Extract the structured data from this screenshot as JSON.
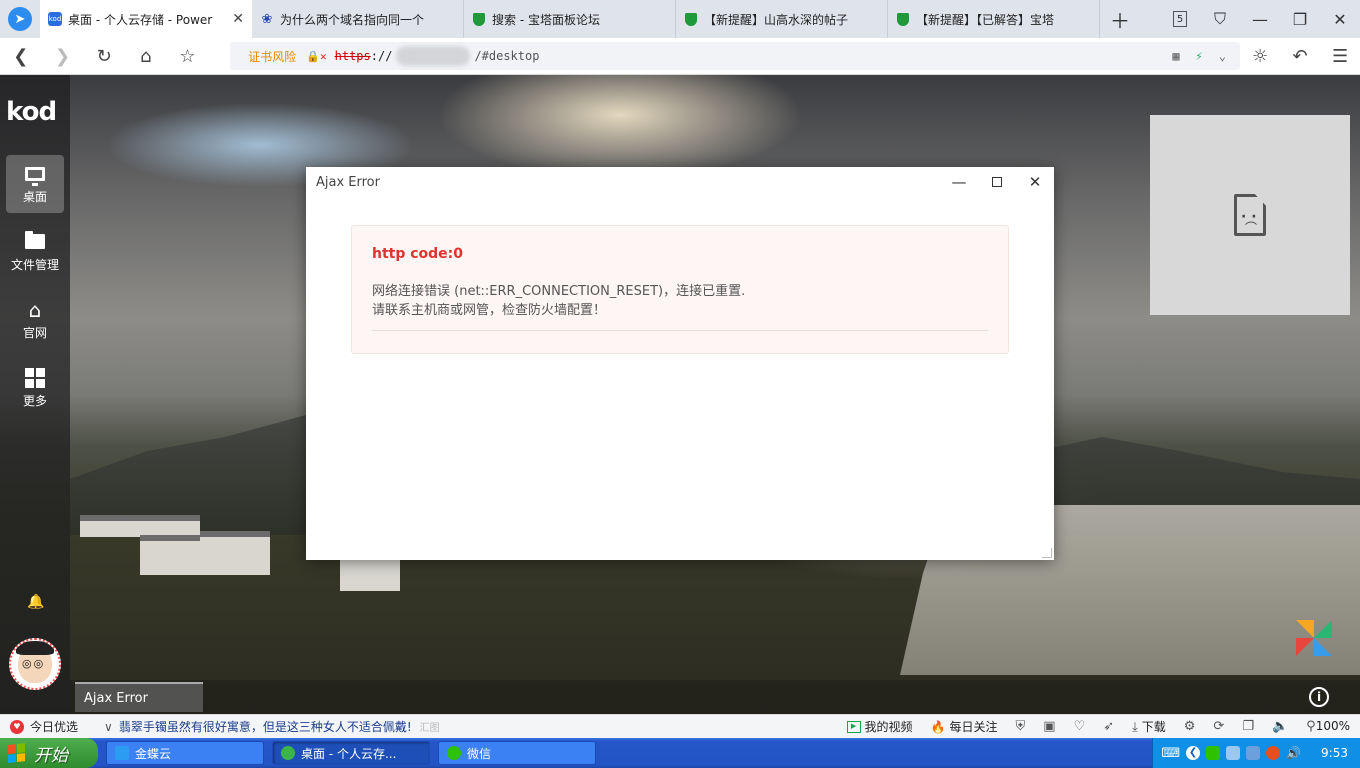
{
  "browser": {
    "tabs": [
      {
        "title": "桌面 - 个人云存储 - Power",
        "favicon": "kod-favicon",
        "active": true
      },
      {
        "title": "为什么两个域名指向同一个",
        "favicon": "baidu-paw-icon",
        "active": false
      },
      {
        "title": "搜索 - 宝塔面板论坛",
        "favicon": "bt-shield-icon",
        "active": false
      },
      {
        "title": "【新提醒】山高水深的帖子",
        "favicon": "bt-shield-icon",
        "active": false
      },
      {
        "title": "【新提醒】【已解答】宝塔",
        "favicon": "bt-shield-icon",
        "active": false
      }
    ],
    "tab_count": "5",
    "cert_warning": "证书风险",
    "url_protocol": "https",
    "url_sep": "://",
    "url_path": "/#desktop",
    "accent": "#2d8cf0"
  },
  "dock": {
    "logo": "kod",
    "items": [
      {
        "label": "桌面",
        "icon": "desktop-monitor-icon",
        "active": true
      },
      {
        "label": "文件管理",
        "icon": "folder-icon",
        "active": false
      },
      {
        "label": "官网",
        "icon": "home-icon",
        "active": false
      },
      {
        "label": "更多",
        "icon": "grid-icon",
        "active": false
      }
    ]
  },
  "dialog": {
    "title": "Ajax Error",
    "error_code": "http code:0",
    "message_line1": "网络连接错误 (net::ERR_CONNECTION_RESET)，连接已重置.",
    "message_line2": "请联系主机商或网管，检查防火墙配置！",
    "error_color": "#e0332f"
  },
  "app_taskbar": {
    "task_label": "Ajax Error"
  },
  "statusbar": {
    "today": "今日优选",
    "news": "翡翠手镯虽然有很好寓意，但是这三种女人不适合佩戴!",
    "ad": "汇图",
    "my_video": "我的视频",
    "daily": "每日关注",
    "download": "下载",
    "zoom": "100%"
  },
  "windows": {
    "start_label": "开始",
    "tasks": [
      {
        "label": "金蝶云",
        "active": false
      },
      {
        "label": "桌面 - 个人云存...",
        "active": true
      },
      {
        "label": "微信",
        "active": false
      }
    ],
    "clock": "9:53"
  }
}
